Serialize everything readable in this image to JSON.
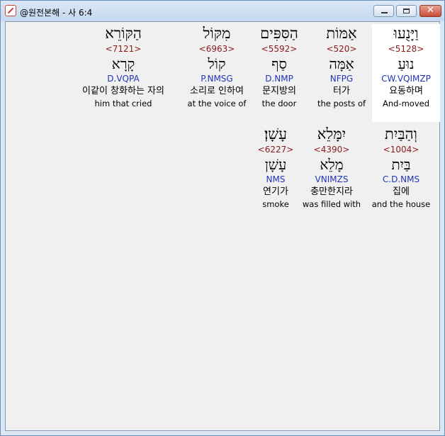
{
  "window": {
    "title": "@원전본해 - 사 6:4",
    "minimize_label": "",
    "maximize_label": "",
    "close_label": "✕"
  },
  "rows": [
    {
      "words": [
        {
          "hebrew": "וַיָּנֻעוּ",
          "strong": "<5128>",
          "lemma": "נוּעַ",
          "morph": "CW.VQIMZP",
          "korean": "요동하며",
          "english": "And-moved",
          "selected": true
        },
        {
          "hebrew": "אַמּוֹת",
          "strong": "<520>",
          "lemma": "אַמָּה",
          "morph": "NFPG",
          "korean": "터가",
          "english": "the posts of",
          "selected": false
        },
        {
          "hebrew": "הַסִּפִּים",
          "strong": "<5592>",
          "lemma": "סַף",
          "morph": "D.NMP",
          "korean": "문지방의",
          "english": "the door",
          "selected": false
        },
        {
          "hebrew": "מִקּוֹל",
          "strong": "<6963>",
          "lemma": "קוֹל",
          "morph": "P.NMSG",
          "korean": "소리로 인하여",
          "english": "at the voice of",
          "selected": false
        },
        {
          "hebrew": "הַקּוֹרֵא",
          "strong": "<7121>",
          "lemma": "קָרָא",
          "morph": "D.VQPA",
          "korean": "이같이 창화하는 자의",
          "english": "him that cried",
          "selected": false
        }
      ]
    },
    {
      "words": [
        {
          "hebrew": "וְהַבַּיִת",
          "strong": "<1004>",
          "lemma": "בַּיִת",
          "morph": "C.D.NMS",
          "korean": "집에",
          "english": "and the house",
          "selected": false
        },
        {
          "hebrew": "יִמָּלֵא",
          "strong": "<4390>",
          "lemma": "מָלֵא",
          "morph": "VNIMZS",
          "korean": "충만한지라",
          "english": "was filled with",
          "selected": false
        },
        {
          "hebrew": "עָשָׁן׃",
          "strong": "<6227>",
          "lemma": "עָשָׁן",
          "morph": "NMS",
          "korean": "연기가",
          "english": "smoke",
          "selected": false
        }
      ]
    }
  ]
}
